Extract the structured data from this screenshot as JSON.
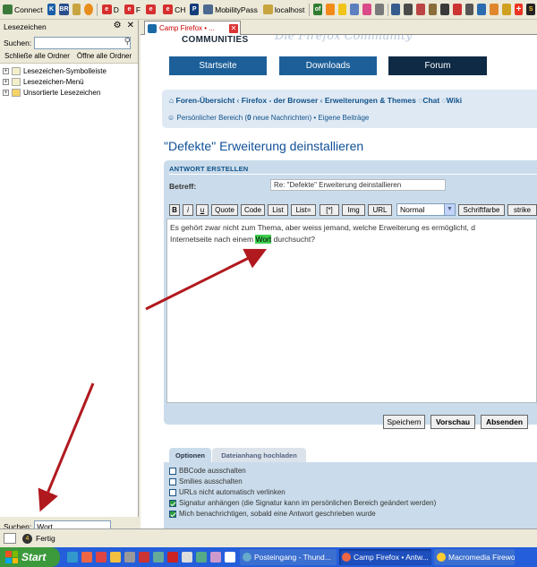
{
  "bookmarks_toolbar": {
    "items": [
      {
        "label": "Connect",
        "icon": "connect-icon",
        "color": "#3c7a3c"
      },
      {
        "label": "",
        "icon": "k-icon",
        "color": "#1b5fa8"
      },
      {
        "label": "",
        "icon": "br-icon",
        "color": "#2a4e8c"
      },
      {
        "label": "",
        "icon": "folder-icon",
        "color": "#c7a440"
      },
      {
        "label": "",
        "icon": "flower-icon",
        "color": "#e88d1d"
      },
      {
        "label": "D",
        "icon": "ebay-icon",
        "color": "#d62f2f"
      },
      {
        "label": "F",
        "icon": "ebay-icon",
        "color": "#d62f2f"
      },
      {
        "label": "",
        "icon": "ebay-icon",
        "color": "#d62f2f"
      },
      {
        "label": "CH",
        "icon": "ebay-icon",
        "color": "#d62f2f"
      },
      {
        "label": "",
        "icon": "p-icon",
        "color": "#123c7a"
      },
      {
        "label": "MobilityPass",
        "icon": "mobility-icon",
        "color": "#4c6a90"
      },
      {
        "label": "localhost",
        "icon": "folder-icon",
        "color": "#c7a440"
      }
    ],
    "right_icons": [
      "of-icon",
      "rss-icon",
      "clock-icon",
      "people-icon",
      "dots-icon",
      "photo-icon",
      "grid-icon",
      "target-icon",
      "gift-icon",
      "bug-icon",
      "pin-icon",
      "flag-icon",
      "skull-icon",
      "arrow-icon",
      "bird-icon",
      "shop-icon",
      "swiss-flag-icon",
      "s-icon"
    ]
  },
  "sidebar": {
    "title": "Lesezeichen",
    "search_label": "Suchen:",
    "search_value": "",
    "collapse_all": "Schließe alle Ordner",
    "expand_all": "Öffne alle Ordner",
    "tree": [
      {
        "label": "Lesezeichen-Symbolleiste"
      },
      {
        "label": "Lesezeichen-Menü"
      },
      {
        "label": "Unsortierte Lesezeichen"
      }
    ],
    "bottom_search_label": "Suchen:",
    "bottom_search_value": "Wort"
  },
  "tab": {
    "label": "Camp Firefox • ..."
  },
  "page": {
    "communities": "COMMUNITIES",
    "faded_title": "Die Firefox Community",
    "nav": {
      "start": "Startseite",
      "downloads": "Downloads",
      "forum": "Forum"
    },
    "breadcrumb": {
      "home": "Foren-Übersicht",
      "sep": "‹",
      "c1": "Firefox - der Browser",
      "c2": "Erweiterungen & Themes",
      "chat": "Chat",
      "wiki": "Wiki"
    },
    "personal": {
      "pre": "Persönlicher Bereich (",
      "count": "0",
      "mid": " neue Nachrichten) • ",
      "own": "Eigene Beiträge"
    },
    "title": "\"Defekte\" Erweiterung deinstallieren",
    "answer_heading": "ANTWORT ERSTELLEN",
    "subject_label": "Betreff:",
    "subject_value": "Re: \"Defekte\" Erweiterung deinstallieren",
    "toolbar": [
      "B",
      "i",
      "u",
      "Quote",
      "Code",
      "List",
      "List=",
      "[*]",
      "Img",
      "URL"
    ],
    "font_size_select": "Normal",
    "font_color": "Schriftfarbe",
    "strike": "strike",
    "editor": {
      "line1": "Es gehört zwar nicht zum Thema, aber weiss jemand, welche Erweiterung es ermöglicht, d",
      "line2_pre": "Internetseite nach einem ",
      "highlight": "Wort",
      "line2_post": " durchsucht?"
    },
    "buttons": {
      "save": "Speichern",
      "preview": "Vorschau",
      "submit": "Absenden"
    },
    "tabs": {
      "options": "Optionen",
      "attachment": "Dateianhang hochladen"
    },
    "options": [
      {
        "label": "BBCode ausschalten",
        "checked": false
      },
      {
        "label": "Smilies ausschalten",
        "checked": false
      },
      {
        "label": "URLs nicht automatisch verlinken",
        "checked": false
      },
      {
        "label": "Signatur anhängen (die Signatur kann im persönlichen Bereich geändert werden)",
        "checked": true
      },
      {
        "label": "Mich benachrichtigen, sobald eine Antwort geschrieben wurde",
        "checked": true
      }
    ]
  },
  "status": {
    "text": "Fertig"
  },
  "taskbar": {
    "start": "Start",
    "tasks": [
      {
        "label": "Posteingang - Thund...",
        "color": "#3b6fd0"
      },
      {
        "label": "Camp Firefox • Antw...",
        "color": "#1e4fbd",
        "active": true
      },
      {
        "label": "Macromedia Firewor...",
        "color": "#3b6fd0"
      }
    ]
  },
  "colors": {
    "accent": "#105289",
    "nav_dark": "#0e2a45",
    "nav_blue": "#1d5f98",
    "highlight": "#3ccf4e",
    "arrow": "#b0191e"
  }
}
